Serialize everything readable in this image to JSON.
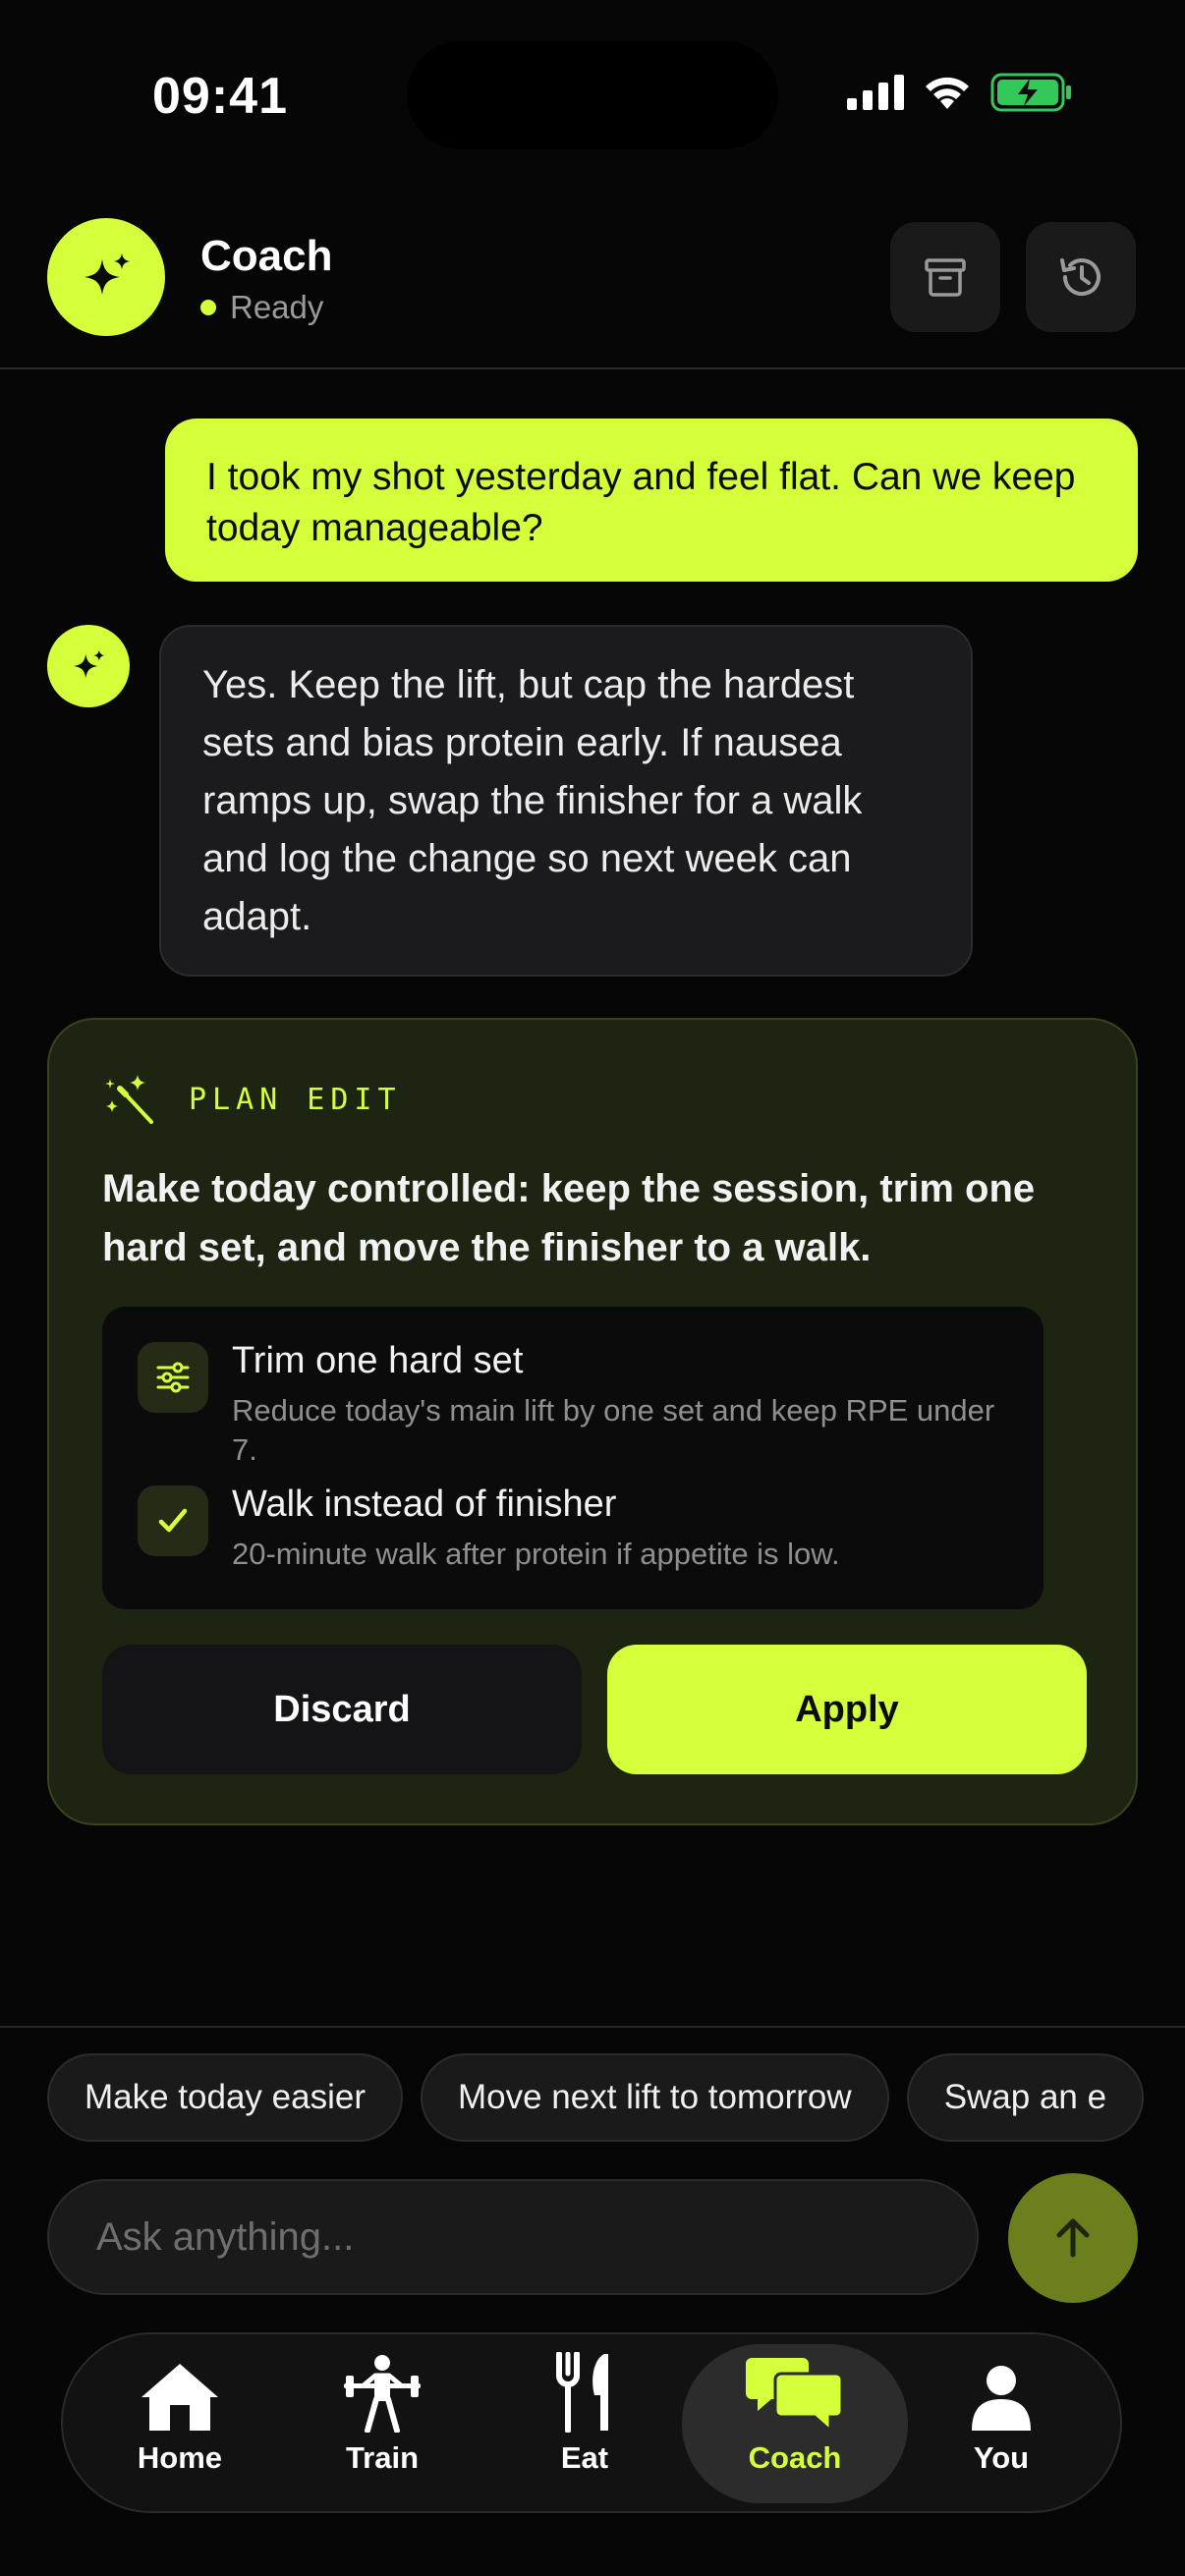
{
  "status": {
    "time": "09:41"
  },
  "header": {
    "title": "Coach",
    "status": "Ready"
  },
  "messages": {
    "user": "I took my shot yesterday and feel flat. Can we keep today manageable?",
    "bot": "Yes. Keep the lift, but cap the hardest sets and bias protein early. If nausea ramps up, swap the finisher for a walk and log the change so next week can adapt."
  },
  "plan_edit": {
    "label": "PLAN EDIT",
    "summary": "Make today controlled: keep the session, trim one hard set, and move the finisher to a walk.",
    "changes": [
      {
        "title": "Trim one hard set",
        "description": "Reduce today's main lift by one set and keep RPE under 7.",
        "icon": "sliders-icon"
      },
      {
        "title": "Walk instead of finisher",
        "description": "20-minute walk after protein if appetite is low.",
        "icon": "check-icon"
      }
    ],
    "discard_label": "Discard",
    "apply_label": "Apply"
  },
  "suggestions": [
    "Make today easier",
    "Move next lift to tomorrow",
    "Swap an e"
  ],
  "input": {
    "placeholder": "Ask anything..."
  },
  "tabs": [
    {
      "label": "Home",
      "icon": "home-icon"
    },
    {
      "label": "Train",
      "icon": "barbell-icon"
    },
    {
      "label": "Eat",
      "icon": "utensils-icon"
    },
    {
      "label": "Coach",
      "icon": "chat-icon",
      "active": true
    },
    {
      "label": "You",
      "icon": "user-icon"
    }
  ],
  "colors": {
    "accent": "#d4ff3a",
    "background": "#060606",
    "card": "#1e2412"
  }
}
